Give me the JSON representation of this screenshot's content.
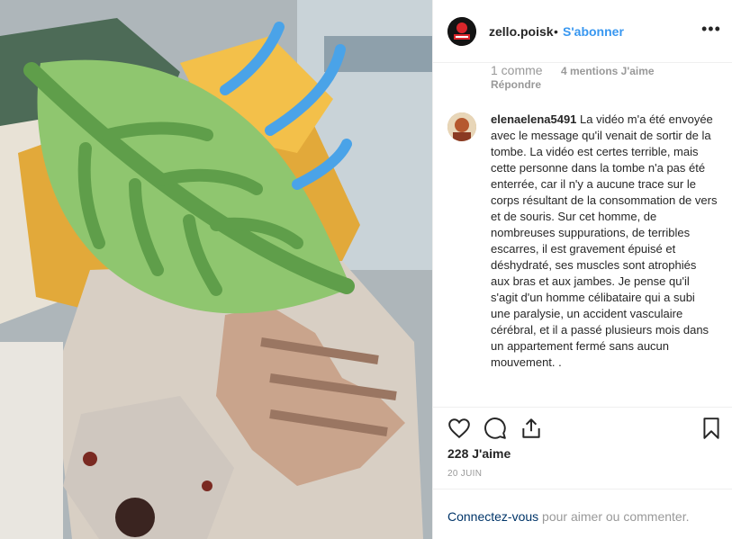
{
  "post": {
    "author": "zello.poisk",
    "separator": "•",
    "follow_label": "S'abonner",
    "more_icon": "more-options-icon",
    "more_glyph": "•••"
  },
  "previous_comment": {
    "reply_count": "1 comme",
    "likes": "4 mentions J'aime",
    "reply_label": "Répondre"
  },
  "comment": {
    "username": "elenaelena5491",
    "text": "La vidéo m'a été envoyée avec le message qu'il venait de sortir de la tombe. La vidéo est certes terrible, mais cette personne dans la tombe n'a pas été enterrée, car il n'y a aucune trace sur le corps résultant de la consommation de vers et de souris. Sur cet homme, de nombreuses suppurations, de terribles escarres, il est gravement épuisé et déshydraté, ses muscles sont atrophiés aux bras et aux jambes. Je pense qu'il s'agit d'un homme célibataire qui a subi une paralysie, un accident vasculaire cérébral, et il a passé plusieurs mois dans un appartement fermé sans aucun mouvement. ."
  },
  "actions": {
    "icons": [
      "heart-icon",
      "comment-icon",
      "share-icon",
      "bookmark-icon"
    ]
  },
  "likes_label": "228 J'aime",
  "date_label": "20 JUIN",
  "login": {
    "link_text": "Connectez-vous",
    "rest_text": " pour aimer ou commenter."
  },
  "colors": {
    "link_blue": "#3897f0",
    "secondary_text": "#999999",
    "leaf_green": "#8fc66f",
    "wind_blue": "#4aa3e8"
  },
  "media_overlay": {
    "emoji": "leaf-fluttering-in-wind-emoji"
  }
}
